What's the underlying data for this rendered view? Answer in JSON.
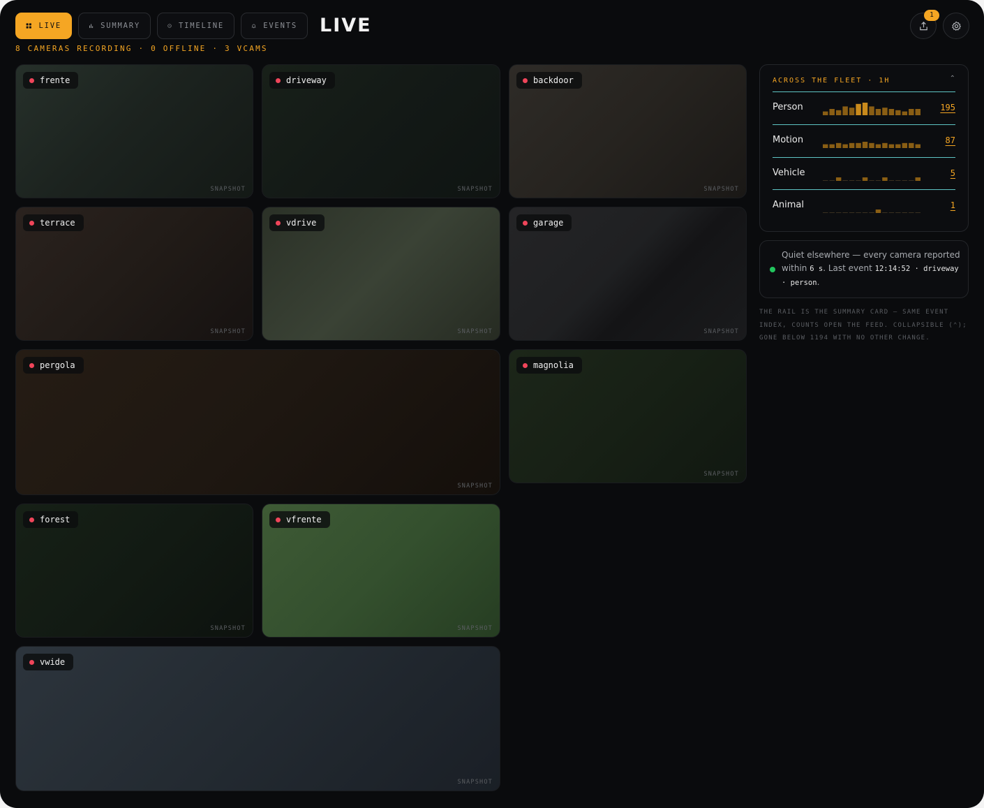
{
  "nav": {
    "tabs": [
      {
        "label": "LIVE",
        "icon": "grid-icon",
        "active": true
      },
      {
        "label": "SUMMARY",
        "icon": "bar-chart-icon",
        "active": false
      },
      {
        "label": "TIMELINE",
        "icon": "clock-icon",
        "active": false
      },
      {
        "label": "EVENTS",
        "icon": "bell-icon",
        "active": false
      }
    ]
  },
  "header": {
    "title": "LIVE",
    "subtitle": "8 CAMERAS RECORDING · 0 OFFLINE · 3 VCAMS",
    "export_badge": "1",
    "export_icon": "share-upload-icon",
    "settings_icon": "gear-icon"
  },
  "colors": {
    "accent": "#f5a623",
    "recording": "#f0455a",
    "ok": "#22c55e",
    "divider": "#5ec4c4"
  },
  "cameras": [
    {
      "name": "frente",
      "badge": "SNAPSHOT"
    },
    {
      "name": "driveway",
      "badge": "SNAPSHOT"
    },
    {
      "name": "backdoor",
      "badge": "SNAPSHOT"
    },
    {
      "name": "terrace",
      "badge": "SNAPSHOT"
    },
    {
      "name": "vdrive",
      "badge": "SNAPSHOT"
    },
    {
      "name": "garage",
      "badge": "SNAPSHOT"
    },
    {
      "name": "pergola",
      "badge": "SNAPSHOT"
    },
    {
      "name": "magnolia",
      "badge": "SNAPSHOT"
    },
    {
      "name": "forest",
      "badge": "SNAPSHOT"
    },
    {
      "name": "vfrente",
      "badge": "SNAPSHOT"
    },
    {
      "name": "vwide",
      "badge": "SNAPSHOT"
    }
  ],
  "fleet": {
    "heading": "ACROSS THE FLEET · 1H",
    "collapse_symbol": "⌃",
    "rows": [
      {
        "label": "Person",
        "count": "195",
        "spark": [
          3,
          5,
          4,
          7,
          6,
          9,
          10,
          7,
          5,
          6,
          5,
          4,
          3,
          5,
          5
        ]
      },
      {
        "label": "Motion",
        "count": "87",
        "spark": [
          3,
          3,
          4,
          3,
          4,
          4,
          5,
          4,
          3,
          4,
          3,
          3,
          4,
          4,
          3
        ]
      },
      {
        "label": "Vehicle",
        "count": "5",
        "spark": [
          0,
          0,
          1,
          0,
          0,
          0,
          2,
          0,
          0,
          1,
          0,
          0,
          0,
          0,
          1
        ]
      },
      {
        "label": "Animal",
        "count": "1",
        "spark": [
          0,
          0,
          0,
          0,
          0,
          0,
          0,
          0,
          1,
          0,
          0,
          0,
          0,
          0,
          0
        ]
      }
    ]
  },
  "quiet": {
    "t1": "Quiet elsewhere — every camera reported within ",
    "seconds": "6 s",
    "t2": ". Last event ",
    "time": "12:14:52 · driveway · person",
    "t3": "."
  },
  "rail_note": "THE RAIL IS THE SUMMARY CARD — SAME EVENT INDEX, COUNTS OPEN THE FEED. COLLAPSIBLE (⌃); GONE BELOW 1194 WITH NO OTHER CHANGE."
}
